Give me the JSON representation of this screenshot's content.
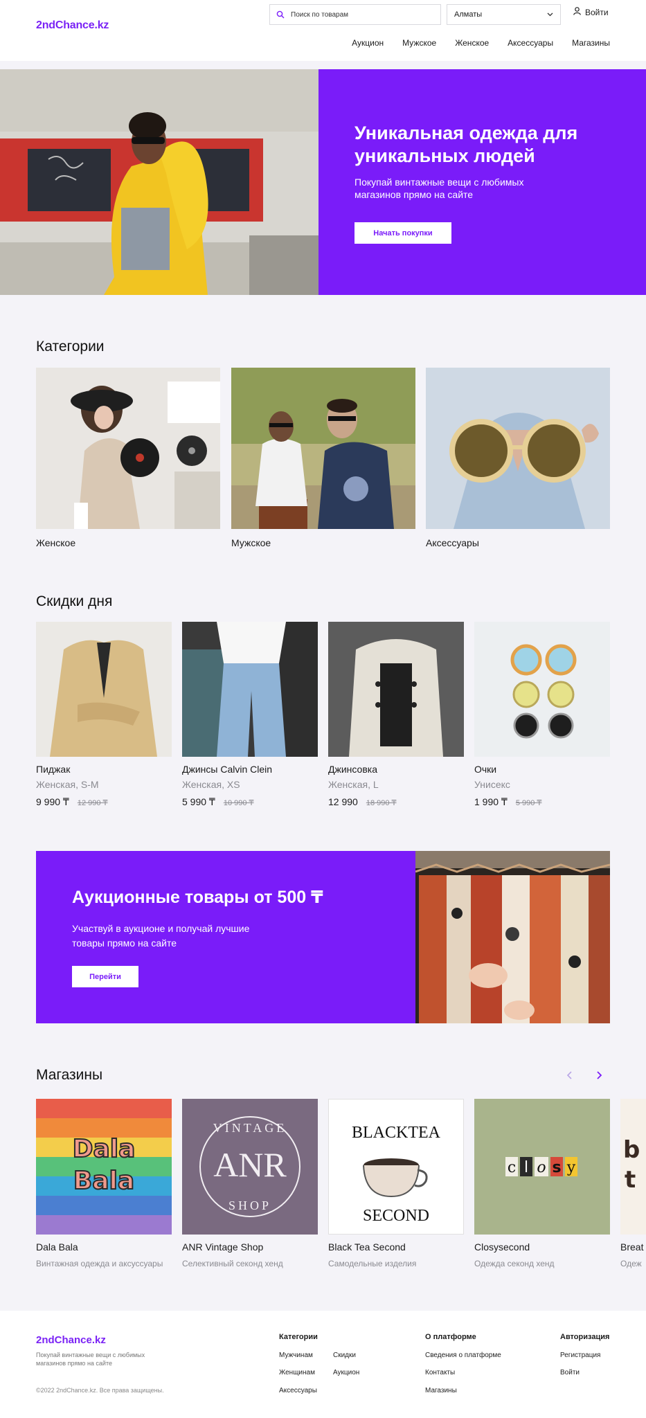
{
  "header": {
    "logo": "2ndChance.kz",
    "search_placeholder": "Поиск по товарам",
    "city": "Алматы",
    "login": "Войти",
    "nav": [
      "Аукцион",
      "Мужское",
      "Женское",
      "Аксессуары",
      "Магазины"
    ]
  },
  "hero": {
    "title": "Уникальная одежда для уникальных людей",
    "subtitle": "Покупай винтажные вещи с любимых магазинов прямо на сайте",
    "button": "Начать покупки"
  },
  "categories": {
    "title": "Категории",
    "items": [
      {
        "label": "Женское"
      },
      {
        "label": "Мужское"
      },
      {
        "label": "Аксессуары"
      }
    ]
  },
  "deals": {
    "title": "Скидки дня",
    "items": [
      {
        "name": "Пиджак",
        "sub": "Женская, S-M",
        "price": "9 990 ₸",
        "old": "12 990 ₸"
      },
      {
        "name": "Джинсы Calvin Clein",
        "sub": "Женская, XS",
        "price": "5 990 ₸",
        "old": "10 990 ₸"
      },
      {
        "name": "Джинсовка",
        "sub": "Женская, L",
        "price": "12 990",
        "old": "18 990 ₸"
      },
      {
        "name": "Очки",
        "sub": "Унисекс",
        "price": "1 990 ₸",
        "old": "5 990 ₸"
      }
    ]
  },
  "auction": {
    "title": "Аукционные товары от 500 ₸",
    "subtitle": "Участвуй в аукционе и получай лучшие товары прямо на сайте",
    "button": "Перейти"
  },
  "shops": {
    "title": "Магазины",
    "items": [
      {
        "name": "Dala Bala",
        "desc": "Винтажная одежда и аксуссуары",
        "logo_lines": [
          "Dala",
          "Bala"
        ]
      },
      {
        "name": "ANR Vintage Shop",
        "desc": "Селективный секонд хенд",
        "logo_main": "ANR",
        "logo_top": "VINTAGE",
        "logo_bottom": "SHOP"
      },
      {
        "name": "Black Tea Second",
        "desc": "Самодельные изделия",
        "logo_top": "BLACKTEA",
        "logo_bottom": "SECOND"
      },
      {
        "name": "Closysecond",
        "desc": "Одежда секонд хенд",
        "logo_letters": [
          "c",
          "l",
          "o",
          "s",
          "y"
        ]
      },
      {
        "name": "Breat",
        "desc": "Одеж",
        "logo_letters": [
          "b",
          "t"
        ]
      }
    ]
  },
  "footer": {
    "logo": "2ndChance.kz",
    "tagline": "Покупай винтажные вещи с любимых магазинов прямо на сайте",
    "copyright": "©2022 2ndChance.kz. Все права защищены.",
    "cols": [
      {
        "title": "Категории",
        "links": [
          "Мужчинам",
          "Скидки",
          "Женщинам",
          "Аукцион",
          "Аксессуары"
        ]
      },
      {
        "title": "О платформе",
        "links": [
          "Сведения о платформе",
          "Контакты",
          "Магазины"
        ]
      },
      {
        "title": "Авторизация",
        "links": [
          "Регистрация",
          "Войти"
        ]
      }
    ]
  },
  "colors": {
    "accent": "#7a1cf9",
    "background": "#f4f3f8"
  }
}
